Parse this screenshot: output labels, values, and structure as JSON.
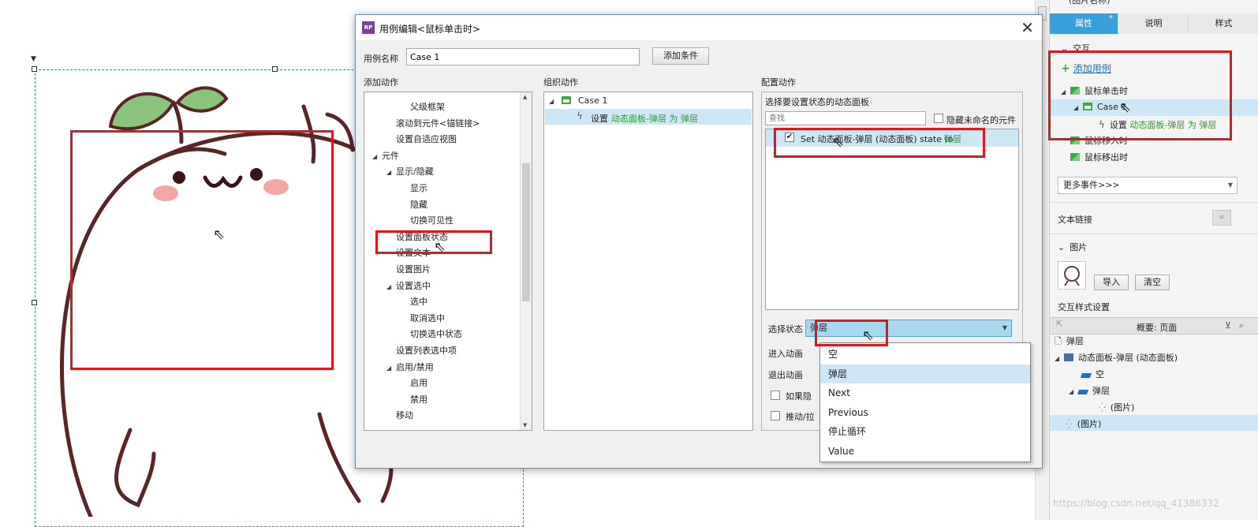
{
  "canvas": {
    "cursor_icon": "cursor-icon"
  },
  "dialog": {
    "title": "用例编辑<鼠标单击时>",
    "case_name_label": "用例名称",
    "case_name_value": "Case 1",
    "add_condition_button": "添加条件",
    "add_action_header": "添加动作",
    "organize_action_header": "组织动作",
    "configure_action_header": "配置动作",
    "action_tree": [
      {
        "label": "父级框架",
        "indent": 3,
        "tri": ""
      },
      {
        "label": "滚动到元件<锚链接>",
        "indent": 2,
        "tri": ""
      },
      {
        "label": "设置自适应视图",
        "indent": 2,
        "tri": ""
      },
      {
        "label": "元件",
        "indent": 1,
        "tri": "◢"
      },
      {
        "label": "显示/隐藏",
        "indent": 2,
        "tri": "◢"
      },
      {
        "label": "显示",
        "indent": 3,
        "tri": ""
      },
      {
        "label": "隐藏",
        "indent": 3,
        "tri": ""
      },
      {
        "label": "切换可见性",
        "indent": 3,
        "tri": ""
      },
      {
        "label": "设置面板状态",
        "indent": 2,
        "tri": ""
      },
      {
        "label": "设置文本",
        "indent": 2,
        "tri": ""
      },
      {
        "label": "设置图片",
        "indent": 2,
        "tri": ""
      },
      {
        "label": "设置选中",
        "indent": 2,
        "tri": "◢"
      },
      {
        "label": "选中",
        "indent": 3,
        "tri": ""
      },
      {
        "label": "取消选中",
        "indent": 3,
        "tri": ""
      },
      {
        "label": "切换选中状态",
        "indent": 3,
        "tri": ""
      },
      {
        "label": "设置列表选中项",
        "indent": 2,
        "tri": ""
      },
      {
        "label": "启用/禁用",
        "indent": 2,
        "tri": "◢"
      },
      {
        "label": "启用",
        "indent": 3,
        "tri": ""
      },
      {
        "label": "禁用",
        "indent": 3,
        "tri": ""
      },
      {
        "label": "移动",
        "indent": 2,
        "tri": ""
      }
    ],
    "organize": {
      "case_label": "Case 1",
      "action_prefix": "设置",
      "action_target": "动态面板-弹层 为 弹层"
    },
    "configure": {
      "select_panel_label": "选择要设置状态的动态面板",
      "search_placeholder": "查找",
      "hide_unnamed_label": "隐藏未命名的元件",
      "row_text": "Set 动态面板-弹层 (动态面板) state to ",
      "row_state": "弹层",
      "select_state_label": "选择状态",
      "select_state_value": "弹层",
      "enter_anim_label": "进入动画",
      "exit_anim_label": "退出动画",
      "checkbox1_label": "如果隐",
      "checkbox2_label": "推动/拉"
    },
    "dropdown_options": [
      "空",
      "弹层",
      "Next",
      "Previous",
      "停止循环",
      "Value"
    ],
    "dropdown_selected": "弹层"
  },
  "sidebar": {
    "header_partial": "(图片名称)",
    "tabs": [
      "属性",
      "说明",
      "样式"
    ],
    "tab_badge": "*",
    "interaction_label": "交互",
    "add_case_link": "添加用例",
    "events": {
      "click": "鼠标单击时",
      "case": "Case 1",
      "action_prefix": "设置",
      "action_target": "动态面板-弹层 为 弹层",
      "mouse_enter": "鼠标移入时",
      "mouse_leave": "鼠标移出时"
    },
    "more_events": "更多事件>>>",
    "text_link_label": "文本链接",
    "image_section": "图片",
    "import_button": "导入",
    "clear_button": "清空",
    "interaction_style": "交互样式设置",
    "outline_title": "概要: 页面",
    "outline": {
      "page": "弹层",
      "panel": "动态面板-弹层 (动态面板)",
      "state_empty": "空",
      "state_popup": "弹层",
      "image_child": "(图片)",
      "image_root": "(图片)"
    }
  },
  "watermark": "https://blog.csdn.net/qq_41386332"
}
